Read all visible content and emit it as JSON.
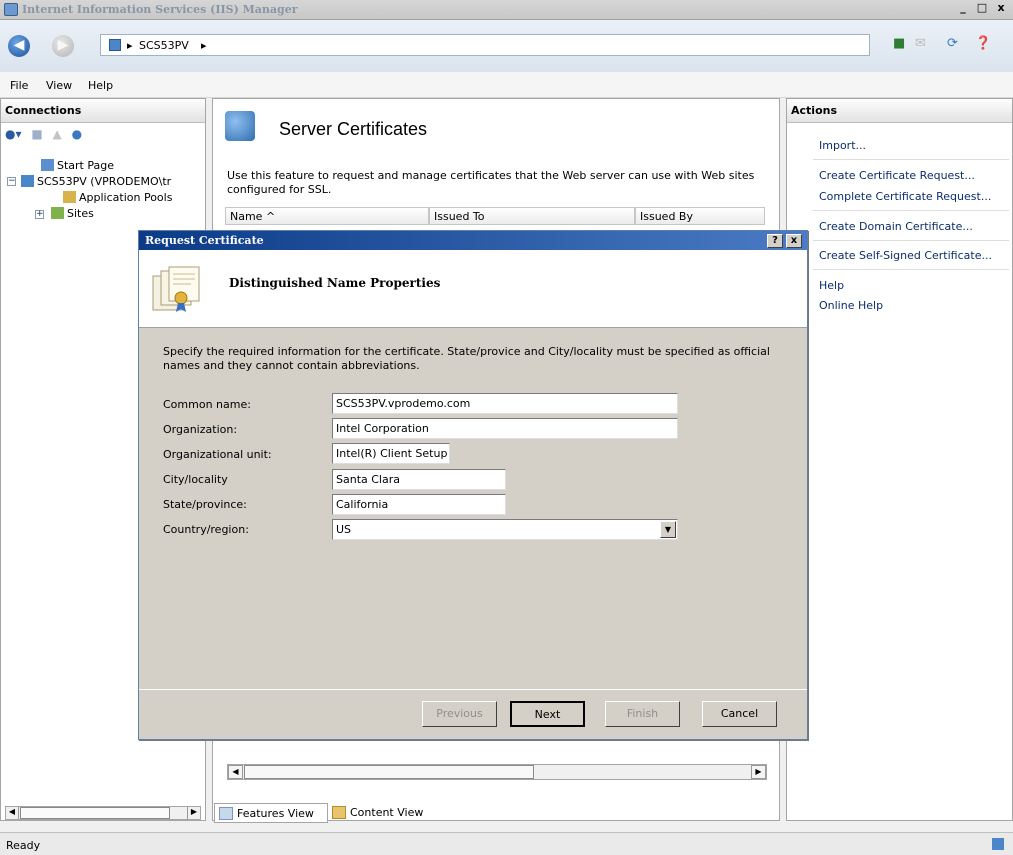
{
  "window": {
    "title": "Internet Information Services (IIS) Manager",
    "controls": [
      "_",
      "□",
      "x"
    ]
  },
  "address": {
    "crumbs": [
      "SCS53PV"
    ],
    "sep": "▸"
  },
  "menu": [
    "File",
    "View",
    "Help"
  ],
  "connections": {
    "header": "Connections",
    "tree": [
      "Start Page",
      "SCS53PV (VPRODEMO\\tr",
      "Application Pools",
      "Sites"
    ]
  },
  "center": {
    "heading": "Server Certificates",
    "description": "Use this feature to request and manage certificates that the Web server can use with Web sites configured for SSL.",
    "columns": [
      "Name ^",
      "Issued To",
      "Issued By"
    ],
    "views": [
      "Features View",
      "Content View"
    ]
  },
  "actions": {
    "header": "Actions",
    "group1": [
      "Import...",
      "Create Certificate Request...",
      "Complete Certificate Request...",
      "Create Domain Certificate...",
      "Create Self-Signed Certificate..."
    ],
    "group2": [
      "Help",
      "Online Help"
    ]
  },
  "status": "Ready",
  "dialog": {
    "title": "Request Certificate",
    "title_buttons": [
      "?",
      "x"
    ],
    "header": "Distinguished Name Properties",
    "intro": "Specify the required information for the certificate. State/provice and City/locality must be specified as official names and they cannot contain abbreviations.",
    "fields": [
      {
        "label": "Common name:",
        "value": "SCS53PV.vprodemo.com"
      },
      {
        "label": "Organization:",
        "value": "Intel Corporation"
      },
      {
        "label": "Organizational unit:",
        "value": "Intel(R) Client Setup"
      },
      {
        "label": "City/locality",
        "value": "Santa Clara"
      },
      {
        "label": "State/province:",
        "value": "California"
      },
      {
        "label": "Country/region:",
        "value": "US"
      }
    ],
    "buttons": [
      "Previous",
      "Next",
      "Finish",
      "Cancel"
    ]
  }
}
